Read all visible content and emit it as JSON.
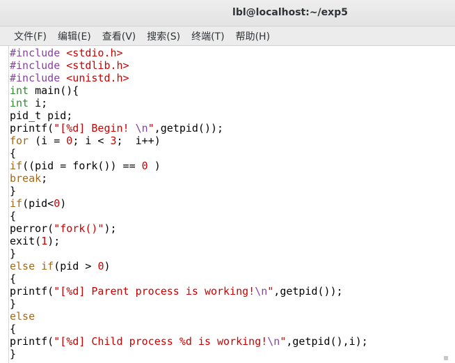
{
  "window": {
    "title": "lbl@localhost:~/exp5"
  },
  "menubar": {
    "items": [
      {
        "label": "文件(F)"
      },
      {
        "label": "编辑(E)"
      },
      {
        "label": "查看(V)"
      },
      {
        "label": "搜索(S)"
      },
      {
        "label": "终端(T)"
      },
      {
        "label": "帮助(H)"
      }
    ]
  },
  "colors": {
    "keyword": "#2e8b2e",
    "control": "#a0681a",
    "preprocessor": "#8a3fa8",
    "string": "#cc0000",
    "number": "#cc0000",
    "plain": "#000000"
  },
  "editor": {
    "lines": [
      [
        [
          "pre",
          "#include "
        ],
        [
          "str",
          "<stdio.h>"
        ]
      ],
      [
        [
          "pre",
          "#include "
        ],
        [
          "str",
          "<stdlib.h>"
        ]
      ],
      [
        [
          "pre",
          "#include "
        ],
        [
          "str",
          "<unistd.h>"
        ]
      ],
      [
        [
          "kw",
          "int"
        ],
        [
          "plain",
          " main(){"
        ]
      ],
      [
        [
          "kw",
          "int"
        ],
        [
          "plain",
          " i;"
        ]
      ],
      [
        [
          "plain",
          "pid_t pid;"
        ]
      ],
      [
        [
          "plain",
          "printf("
        ],
        [
          "str",
          "\"[%d] Begin! "
        ],
        [
          "esc",
          "\\n"
        ],
        [
          "str",
          "\""
        ],
        [
          "plain",
          ",getpid());"
        ]
      ],
      [
        [
          "ctl",
          "for"
        ],
        [
          "plain",
          " (i = "
        ],
        [
          "num",
          "0"
        ],
        [
          "plain",
          "; i < "
        ],
        [
          "num",
          "3"
        ],
        [
          "plain",
          ";  i++)"
        ]
      ],
      [
        [
          "plain",
          "{"
        ]
      ],
      [
        [
          "ctl",
          "if"
        ],
        [
          "plain",
          "((pid = fork()) == "
        ],
        [
          "num",
          "0"
        ],
        [
          "plain",
          " )"
        ]
      ],
      [
        [
          "ctl",
          "break"
        ],
        [
          "plain",
          ";"
        ]
      ],
      [
        [
          "plain",
          "}"
        ]
      ],
      [
        [
          "ctl",
          "if"
        ],
        [
          "plain",
          "(pid<"
        ],
        [
          "num",
          "0"
        ],
        [
          "plain",
          ")"
        ]
      ],
      [
        [
          "plain",
          "{"
        ]
      ],
      [
        [
          "plain",
          "perror("
        ],
        [
          "str",
          "\"fork()\""
        ],
        [
          "plain",
          ");"
        ]
      ],
      [
        [
          "plain",
          "exit("
        ],
        [
          "num",
          "1"
        ],
        [
          "plain",
          ");"
        ]
      ],
      [
        [
          "plain",
          "}"
        ]
      ],
      [
        [
          "ctl",
          "else"
        ],
        [
          "plain",
          " "
        ],
        [
          "ctl",
          "if"
        ],
        [
          "plain",
          "(pid > "
        ],
        [
          "num",
          "0"
        ],
        [
          "plain",
          ")"
        ]
      ],
      [
        [
          "plain",
          "{"
        ]
      ],
      [
        [
          "plain",
          "printf("
        ],
        [
          "str",
          "\"[%d] Parent process is working!"
        ],
        [
          "esc",
          "\\n"
        ],
        [
          "str",
          "\""
        ],
        [
          "plain",
          ",getpid());"
        ]
      ],
      [
        [
          "plain",
          "}"
        ]
      ],
      [
        [
          "ctl",
          "else"
        ]
      ],
      [
        [
          "plain",
          "{"
        ]
      ],
      [
        [
          "plain",
          "printf("
        ],
        [
          "str",
          "\"[%d] Child process %d is working!"
        ],
        [
          "esc",
          "\\n"
        ],
        [
          "str",
          "\""
        ],
        [
          "plain",
          ",getpid(),i);"
        ]
      ],
      [
        [
          "plain",
          "}"
        ]
      ]
    ]
  }
}
